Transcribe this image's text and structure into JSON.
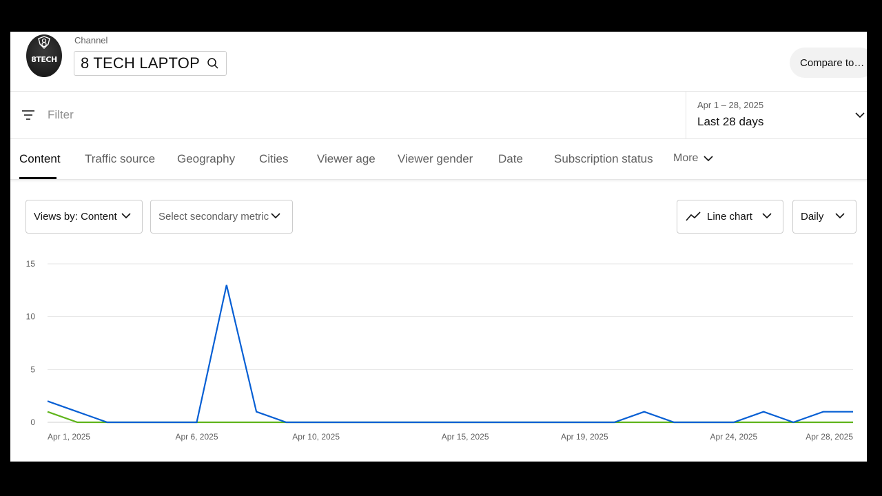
{
  "header": {
    "channel_label": "Channel",
    "channel_name": "8 TECH LAPTOP",
    "avatar_text": "8TECH",
    "compare_label": "Compare to…"
  },
  "filter": {
    "placeholder": "Filter"
  },
  "date_picker": {
    "range": "Apr 1 – 28, 2025",
    "label": "Last 28 days"
  },
  "tabs": [
    {
      "label": "Content",
      "active": true
    },
    {
      "label": "Traffic source"
    },
    {
      "label": "Geography"
    },
    {
      "label": "Cities"
    },
    {
      "label": "Viewer age"
    },
    {
      "label": "Viewer gender"
    },
    {
      "label": "Date"
    },
    {
      "label": "Subscription status"
    },
    {
      "label": "More"
    }
  ],
  "controls": {
    "metric": "Views by: Content",
    "secondary_metric": "Select secondary metric",
    "chart_type": "Line chart",
    "interval": "Daily"
  },
  "chart_data": {
    "type": "line",
    "title": "",
    "xlabel": "",
    "ylabel": "",
    "ylim": [
      0,
      15
    ],
    "yticks": [
      0,
      5,
      10,
      15
    ],
    "grid": true,
    "x": [
      "Apr 1, 2025",
      "Apr 2, 2025",
      "Apr 3, 2025",
      "Apr 4, 2025",
      "Apr 5, 2025",
      "Apr 6, 2025",
      "Apr 7, 2025",
      "Apr 8, 2025",
      "Apr 9, 2025",
      "Apr 10, 2025",
      "Apr 11, 2025",
      "Apr 12, 2025",
      "Apr 13, 2025",
      "Apr 14, 2025",
      "Apr 15, 2025",
      "Apr 16, 2025",
      "Apr 17, 2025",
      "Apr 18, 2025",
      "Apr 19, 2025",
      "Apr 20, 2025",
      "Apr 21, 2025",
      "Apr 22, 2025",
      "Apr 23, 2025",
      "Apr 24, 2025",
      "Apr 25, 2025",
      "Apr 26, 2025",
      "Apr 27, 2025",
      "Apr 28, 2025"
    ],
    "xtick_labels": [
      "Apr 1, 2025",
      "Apr 6, 2025",
      "Apr 10, 2025",
      "Apr 15, 2025",
      "Apr 19, 2025",
      "Apr 24, 2025",
      "Apr 28, 2025"
    ],
    "series": [
      {
        "color": "#065fd4",
        "values": [
          2,
          1,
          0,
          0,
          0,
          0,
          13,
          1,
          0,
          0,
          0,
          0,
          0,
          0,
          0,
          0,
          0,
          0,
          0,
          0,
          1,
          0,
          0,
          0,
          1,
          0,
          1,
          1
        ]
      },
      {
        "color": "#5fb41b",
        "values": [
          1,
          0,
          0,
          0,
          0,
          0,
          0,
          0,
          0,
          0,
          0,
          0,
          0,
          0,
          0,
          0,
          0,
          0,
          0,
          0,
          0,
          0,
          0,
          0,
          0,
          0,
          0,
          0
        ]
      }
    ]
  }
}
